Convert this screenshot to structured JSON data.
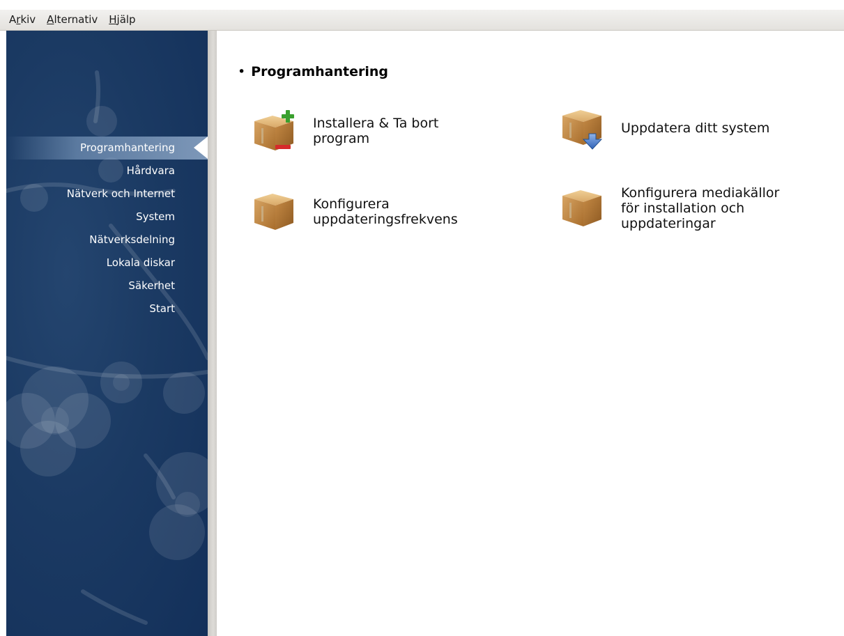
{
  "menubar": {
    "items": [
      {
        "label_pre": "A",
        "label_u": "r",
        "label_post": "kiv"
      },
      {
        "label_pre": "",
        "label_u": "A",
        "label_post": "lternativ"
      },
      {
        "label_pre": "",
        "label_u": "H",
        "label_post": "jälp"
      }
    ]
  },
  "sidebar": {
    "items": [
      {
        "label": "Programhantering",
        "active": true
      },
      {
        "label": "Hårdvara"
      },
      {
        "label": "Nätverk och Internet"
      },
      {
        "label": "System"
      },
      {
        "label": "Nätverksdelning"
      },
      {
        "label": "Lokala diskar"
      },
      {
        "label": "Säkerhet"
      },
      {
        "label": "Start"
      }
    ]
  },
  "main": {
    "section_title": "Programhantering",
    "tools": [
      {
        "label": "Installera & Ta bort\nprogram",
        "icon": "package-add-remove-icon"
      },
      {
        "label": "Uppdatera ditt system",
        "icon": "package-update-icon"
      },
      {
        "label": "Konfigurera\nuppdateringsfrekvens",
        "icon": "package-icon"
      },
      {
        "label": "Konfigurera mediakällor\nför installation och\nuppdateringar",
        "icon": "package-icon"
      }
    ]
  },
  "colors": {
    "sidebar_bg": "#1b3a63",
    "menubar_bg": "#e8e6e2",
    "text": "#111111"
  }
}
